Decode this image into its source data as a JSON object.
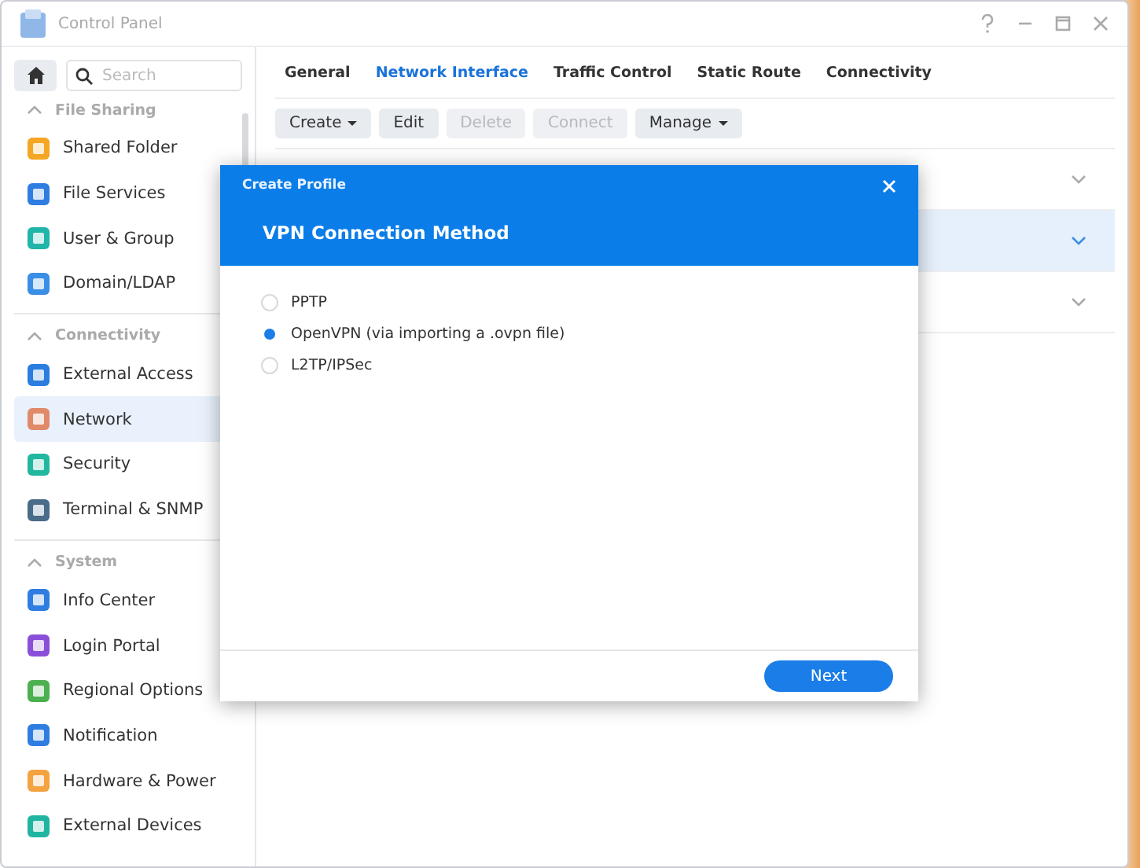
{
  "window": {
    "title": "Control Panel"
  },
  "sidebar": {
    "search": {
      "placeholder": "Search"
    },
    "groups": [
      {
        "title": "File Sharing",
        "expanded": true,
        "items": [
          {
            "label": "Shared Folder",
            "selected": false
          },
          {
            "label": "File Services",
            "selected": false
          },
          {
            "label": "User & Group",
            "selected": false
          },
          {
            "label": "Domain/LDAP",
            "selected": false
          }
        ]
      },
      {
        "title": "Connectivity",
        "expanded": true,
        "items": [
          {
            "label": "External Access",
            "selected": false
          },
          {
            "label": "Network",
            "selected": true
          },
          {
            "label": "Security",
            "selected": false
          },
          {
            "label": "Terminal & SNMP",
            "selected": false
          }
        ]
      },
      {
        "title": "System",
        "expanded": true,
        "items": [
          {
            "label": "Info Center",
            "selected": false
          },
          {
            "label": "Login Portal",
            "selected": false
          },
          {
            "label": "Regional Options",
            "selected": false
          },
          {
            "label": "Notification",
            "selected": false
          },
          {
            "label": "Hardware & Power",
            "selected": false
          },
          {
            "label": "External Devices",
            "selected": false
          }
        ]
      }
    ]
  },
  "tabs": [
    {
      "label": "General",
      "selected": false
    },
    {
      "label": "Network Interface",
      "selected": true
    },
    {
      "label": "Traffic Control",
      "selected": false
    },
    {
      "label": "Static Route",
      "selected": false
    },
    {
      "label": "Connectivity",
      "selected": false
    }
  ],
  "toolbar": [
    {
      "label": "Create",
      "menu": true,
      "disabled": false
    },
    {
      "label": "Edit",
      "menu": false,
      "disabled": false
    },
    {
      "label": "Delete",
      "menu": false,
      "disabled": true
    },
    {
      "label": "Connect",
      "menu": false,
      "disabled": true
    },
    {
      "label": "Manage",
      "menu": true,
      "disabled": false
    }
  ],
  "interfaces": [
    {
      "selected": false
    },
    {
      "selected": true
    },
    {
      "selected": false
    }
  ],
  "dialog": {
    "title": "Create Profile",
    "heading": "VPN Connection Method",
    "options": [
      {
        "label": "PPTP",
        "selected": false
      },
      {
        "label": "OpenVPN (via importing a .ovpn file)",
        "selected": true
      },
      {
        "label": "L2TP/IPSec",
        "selected": false
      }
    ],
    "button": "Next"
  }
}
